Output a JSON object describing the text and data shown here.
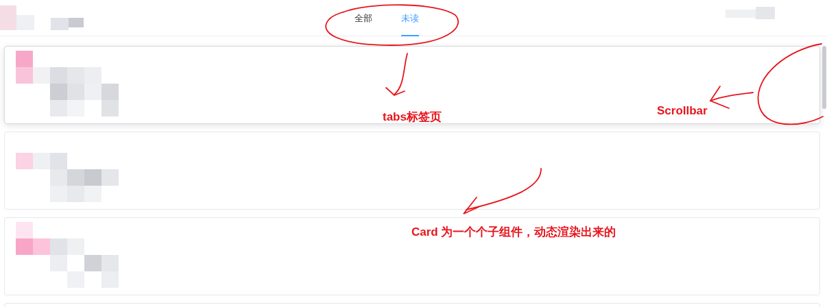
{
  "header": {
    "tabs": [
      {
        "label": "全部",
        "selected": false
      },
      {
        "label": "未读",
        "selected": true
      }
    ]
  },
  "cards": [
    {
      "hovered": true
    },
    {
      "hovered": false
    },
    {
      "hovered": false
    },
    {
      "hovered": false
    }
  ],
  "annotations": [
    {
      "text": "tabs标签页"
    },
    {
      "text": "Scrollbar"
    },
    {
      "text": "Card 为一个个子组件，动态渲染出来的"
    }
  ]
}
